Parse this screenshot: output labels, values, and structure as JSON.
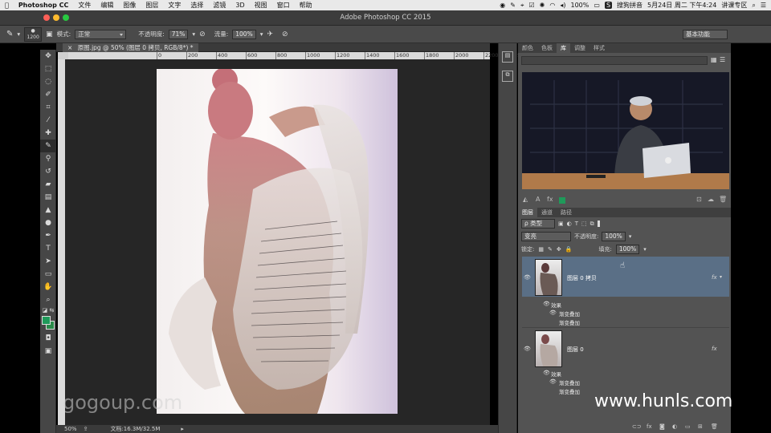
{
  "menubar": {
    "app_name": "Photoshop CC",
    "items": [
      "文件",
      "编辑",
      "图像",
      "图层",
      "文字",
      "选择",
      "滤镜",
      "3D",
      "视图",
      "窗口",
      "帮助"
    ],
    "battery": "100%",
    "ime": "搜狗拼音",
    "datetime": "5月24日 周二 下午4:24",
    "user": "讲课专区"
  },
  "window": {
    "title": "Adobe Photoshop CC 2015"
  },
  "options": {
    "brush_size": "1200",
    "mode_label": "模式:",
    "mode_value": "正常",
    "opacity_label": "不透明度:",
    "opacity_value": "71%",
    "flow_label": "流量:",
    "flow_value": "100%",
    "workspace": "基本功能"
  },
  "document": {
    "tab_title": "原图.jpg @ 50% (图层 0 拷贝, RGB/8*) *",
    "ruler_ticks": [
      "0",
      "200",
      "400",
      "600",
      "800",
      "1000",
      "1200",
      "1400",
      "1600",
      "1800",
      "2000",
      "2200",
      "2400",
      "2600"
    ],
    "zoom": "50%",
    "doc_size": "文档:16.3M/32.5M"
  },
  "top_panel": {
    "tabs": [
      "颜色",
      "色板",
      "库",
      "调整",
      "样式"
    ],
    "active_tab": "库"
  },
  "layers_panel": {
    "tabs": [
      "图层",
      "通道",
      "路径"
    ],
    "filter_label": "ρ 类型",
    "blend_mode": "变亮",
    "opacity_label": "不透明度:",
    "opacity_value": "100%",
    "lock_label": "锁定:",
    "fill_label": "填充:",
    "fill_value": "100%",
    "layers": [
      {
        "name": "图层 0 拷贝",
        "effects_label": "效果",
        "effects": [
          "渐变叠加",
          "渐变叠加"
        ],
        "fx": "fx",
        "selected": true
      },
      {
        "name": "图层 0",
        "effects_label": "效果",
        "effects": [
          "渐变叠加",
          "渐变叠加"
        ],
        "fx": "fx",
        "selected": false
      }
    ]
  },
  "watermarks": {
    "left": "gogoup.com",
    "right": "www.hunls.com"
  },
  "colors": {
    "selected_layer": "#5a6f86",
    "foreground": "#1f9a5a",
    "background": "#2a8a4a"
  }
}
